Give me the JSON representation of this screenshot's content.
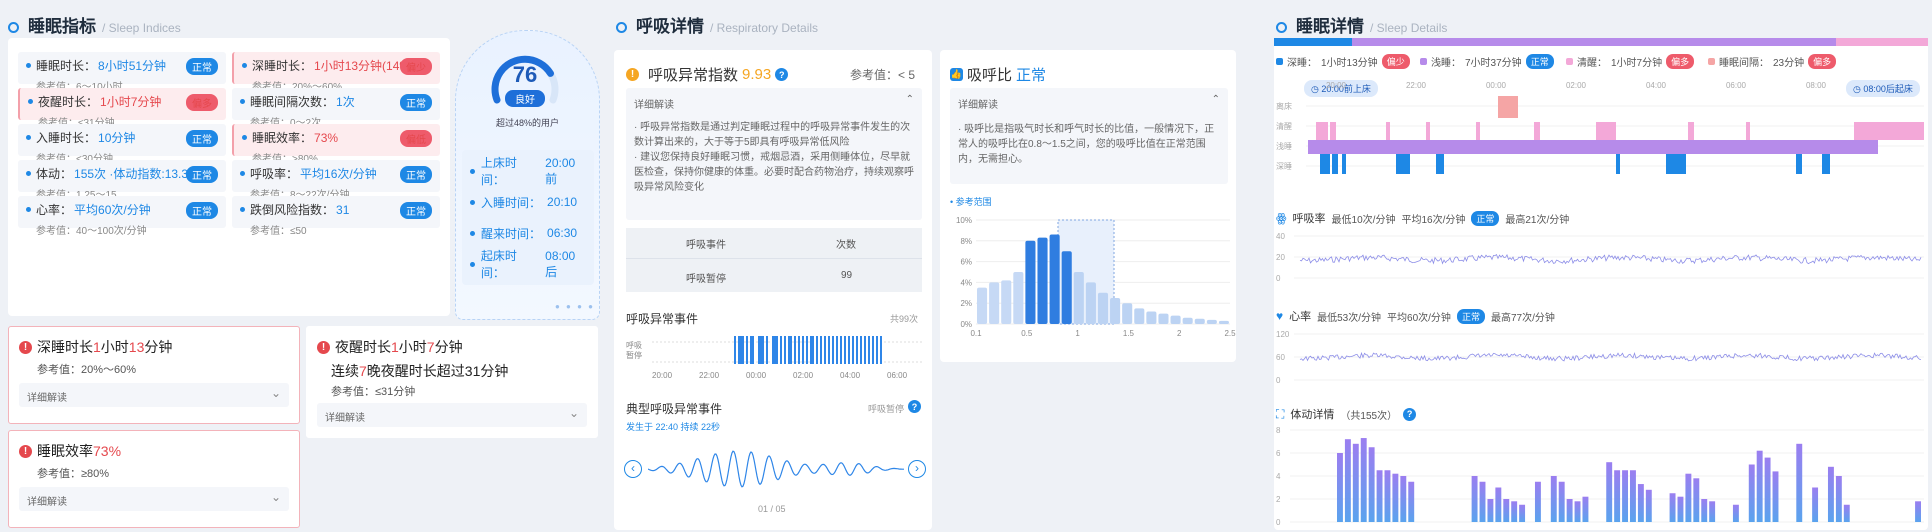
{
  "p1": {
    "title": "睡眠指标",
    "sub": "/ Sleep Indices",
    "cells": [
      {
        "label": "睡眠时长：",
        "value": "8小时51分钟",
        "ref": "参考值：6～10小时",
        "badge": "正常",
        "warn": false
      },
      {
        "label": "深睡时长：",
        "value": "1小时13分钟(14%)",
        "ref": "参考值：20%～60%",
        "badge": "偏少",
        "warn": true
      },
      {
        "label": "夜醒时长：",
        "value": "1小时7分钟",
        "ref": "参考值：≤31分钟",
        "badge": "偏多",
        "warn": true
      },
      {
        "label": "睡眠间隔次数：",
        "value": "1次",
        "ref": "参考值：0～2次",
        "badge": "正常",
        "warn": false
      },
      {
        "label": "入睡时长：",
        "value": "10分钟",
        "ref": "参考值：<30分钟",
        "badge": "正常",
        "warn": false
      },
      {
        "label": "睡眠效率：",
        "value": "73%",
        "ref": "参考值：>80%",
        "badge": "偏低",
        "warn": true
      },
      {
        "label": "体动：",
        "value": "155次 ·体动指数:13.34",
        "ref": "参考值：1.25～15",
        "badge": "正常",
        "warn": false
      },
      {
        "label": "呼吸率：",
        "value": "平均16次/分钟",
        "ref": "参考值：8～22次/分钟",
        "badge": "正常",
        "warn": false
      },
      {
        "label": "心率：",
        "value": "平均60次/分钟",
        "ref": "参考值：40～100次/分钟",
        "badge": "正常",
        "warn": false
      },
      {
        "label": "跌倒风险指数：",
        "value": "31",
        "ref": "参考值：≤50",
        "badge": "正常",
        "warn": false
      }
    ],
    "score": {
      "value": "76",
      "grade": "良好",
      "note": "超过48%的用户",
      "percent": 0.76
    },
    "times": [
      {
        "label": "上床时间：",
        "value": "20:00前"
      },
      {
        "label": "入睡时间：",
        "value": "20:10"
      },
      {
        "label": "醒来时间：",
        "value": "06:30"
      },
      {
        "label": "起床时间：",
        "value": "08:00后"
      }
    ],
    "warn1": {
      "title_a": "深睡时长 ",
      "title_b": "1",
      "title_c": "小时",
      "title_d": "13",
      "title_e": "分钟",
      "ref": "参考值：20%～60%",
      "dd": "详细解读"
    },
    "warn2": {
      "title_a": "夜醒时长 ",
      "title_b": "1",
      "title_c": "小时",
      "title_d": "7",
      "title_e": "分钟",
      "line2_a": "连续",
      "line2_b": "7",
      "line2_c": "晚夜醒时长超过31分钟",
      "ref": "参考值：≤31分钟",
      "dd": "详细解读"
    },
    "warn3": {
      "title_a": "睡眠效率 ",
      "title_b": "73%",
      "ref": "参考值：≥80%",
      "dd": "详细解读"
    }
  },
  "p2": {
    "title": "呼吸详情",
    "sub": "/ Respiratory Details",
    "ahi_label": "呼吸异常指数",
    "ahi_value": "9.93",
    "ahi_ref": "参考值：< 5",
    "ahi_dd": "详细解读",
    "ahi_text": "· 呼吸异常指数是通过判定睡眠过程中的呼吸异常事件发生的次数计算出来的，大于等于5即具有呼吸异常低风险\n· 建议您保持良好睡眠习惯，戒烟忌酒，采用侧睡体位，尽早就医检查，保持你健康的体重。必要时配合药物治疗，持续观察呼吸异常风险变化",
    "table": {
      "h1": "呼吸事件",
      "h2": "次数",
      "r1": "呼吸暂停",
      "r2": "99"
    },
    "ratio_label": "吸呼比",
    "ratio_value": "正常",
    "ratio_dd": "详细解读",
    "ratio_text": "· 吸呼比是指吸气时长和呼气时长的比值，一般情况下，正常人的吸呼比在0.8～1.5之间，您的吸呼比值在正常范围内，无需担心。",
    "ratio_ref_label": "参考范围",
    "hist": {
      "yticks": [
        "10%",
        "8%",
        "6%",
        "4%",
        "2%",
        "0%"
      ],
      "xticks": [
        "0.1",
        "0.5",
        "1",
        "1.5",
        "2",
        "2.5"
      ],
      "values": [
        3.5,
        4,
        4.2,
        5,
        8,
        8.3,
        8.6,
        7,
        5,
        4,
        3,
        2.5,
        2,
        1.5,
        1.2,
        1,
        0.8,
        0.6,
        0.5,
        0.4,
        0.3
      ]
    },
    "events_title": "呼吸异常事件",
    "events_count": "共99次",
    "events_ylab1": "呼吸",
    "events_ylab2": "暂停",
    "events_x": [
      "20:00",
      "22:00",
      "00:00",
      "02:00",
      "04:00",
      "06:00"
    ],
    "typical_title": "典型呼吸异常事件",
    "typical_type": "呼吸暂停",
    "typical_sub": "发生于 22:40  持续 22秒",
    "typical_page": "01 / 05"
  },
  "p3": {
    "title": "睡眠详情",
    "sub": "/ Sleep Details",
    "legend": [
      {
        "n": "深睡：",
        "v": "1小时13分钟",
        "b": "偏少",
        "c": "#1e88e5"
      },
      {
        "n": "浅睡：",
        "v": "7小时37分钟",
        "b": "正常",
        "c": "#b68bea"
      },
      {
        "n": "清醒：",
        "v": "1小时7分钟",
        "b": "偏多",
        "c": "#f3a8d8"
      },
      {
        "n": "睡眠间隔：",
        "v": "23分钟",
        "b": "偏多",
        "c": "#f5a5a5"
      }
    ],
    "start_tag": "20:00前上床",
    "end_tag": "08:00后起床",
    "hyp_x": [
      "20:00",
      "22:00",
      "00:00",
      "02:00",
      "04:00",
      "06:00",
      "08:00"
    ],
    "hyp_y": [
      "离床",
      "清醒",
      "浅睡",
      "深睡"
    ],
    "rr_title": "呼吸率",
    "rr_min": "最低10次/分钟",
    "rr_avg": "平均16次/分钟",
    "rr_badge": "正常",
    "rr_max": "最高21次/分钟",
    "rr_y": [
      "40",
      "20",
      "0"
    ],
    "hr_title": "心率",
    "hr_min": "最低53次/分钟",
    "hr_avg": "平均60次/分钟",
    "hr_badge": "正常",
    "hr_max": "最高77次/分钟",
    "hr_y": [
      "120",
      "60",
      "0"
    ],
    "mv_title": "体动详情",
    "mv_count": "（共155次）",
    "mv_y": [
      "8",
      "6",
      "4",
      "2",
      "0"
    ],
    "mv_values": [
      6,
      7.2,
      6.8,
      7.3,
      6.5,
      4.5,
      4.5,
      4.2,
      4,
      3.5,
      0,
      0,
      0,
      0,
      0,
      0,
      0,
      4,
      3.5,
      2,
      3,
      2,
      1.8,
      1.5,
      0,
      3.5,
      0,
      4,
      3.5,
      2,
      1.8,
      2.2,
      0,
      0,
      5.2,
      4.5,
      4.5,
      4.5,
      3.3,
      2.8,
      0,
      0,
      2.5,
      2.2,
      4.2,
      3.8,
      2,
      1.8,
      0,
      0,
      1.5,
      0,
      5,
      6.2,
      5.6,
      4.4,
      0,
      0,
      6.8,
      0,
      3,
      0,
      4.8,
      4,
      1.5,
      0,
      0,
      0,
      0,
      0,
      0,
      0,
      0,
      1.8
    ]
  }
}
